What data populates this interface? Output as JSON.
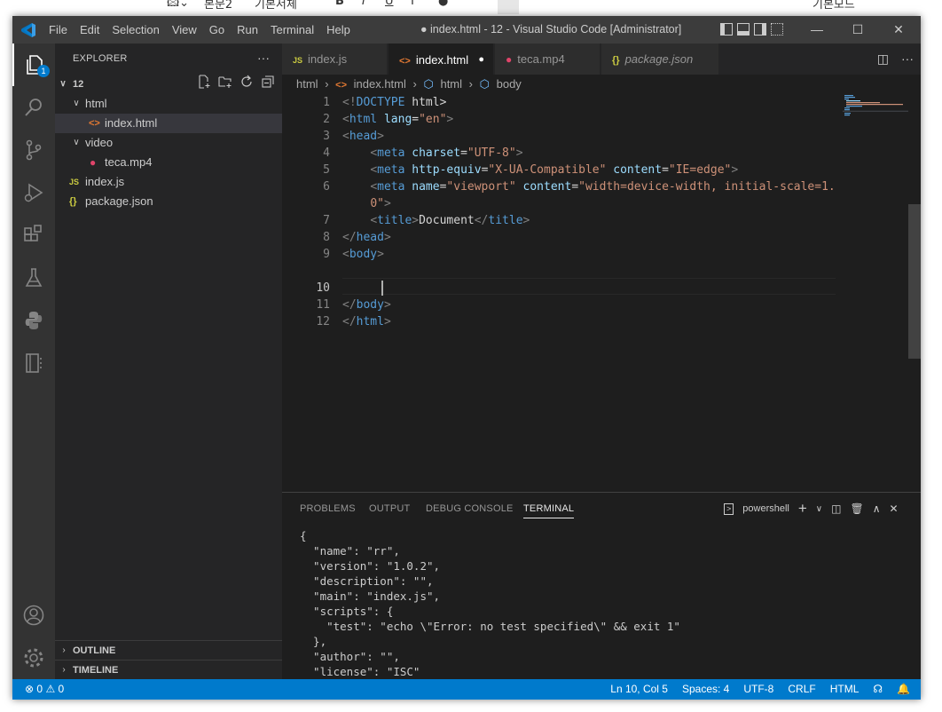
{
  "host_toolbar": {
    "items": [
      "본문2",
      "기본서체",
      "B",
      "I",
      "U",
      "T",
      "●",
      "“",
      "“",
      "기본모드"
    ]
  },
  "window": {
    "title": "● index.html - 12 - Visual Studio Code [Administrator]",
    "menu": [
      "File",
      "Edit",
      "Selection",
      "View",
      "Go",
      "Run",
      "Terminal",
      "Help"
    ],
    "controls": {
      "minimize": "—",
      "maximize": "☐",
      "close": "✕"
    }
  },
  "activity_bar": {
    "badge": "1",
    "items": [
      "explorer-icon",
      "search-icon",
      "source-control-icon",
      "run-debug-icon",
      "extensions-icon",
      "testing-icon",
      "python-icon",
      "notebook-icon",
      "account-icon",
      "settings-gear-icon"
    ]
  },
  "sidebar": {
    "title": "EXPLORER",
    "more": "···",
    "root": "12",
    "tree": [
      {
        "label": "html",
        "type": "folder",
        "icon": ""
      },
      {
        "label": "index.html",
        "type": "file",
        "icon": "<>"
      },
      {
        "label": "video",
        "type": "folder",
        "icon": ""
      },
      {
        "label": "teca.mp4",
        "type": "file",
        "icon": "●"
      },
      {
        "label": "index.js",
        "type": "file",
        "icon": "JS"
      },
      {
        "label": "package.json",
        "type": "file",
        "icon": "{}"
      }
    ],
    "outline": "OUTLINE",
    "timeline": "TIMELINE"
  },
  "tabs": [
    {
      "label": "index.js",
      "icon": "JS"
    },
    {
      "label": "index.html",
      "icon": "<>",
      "dirty": "●"
    },
    {
      "label": "teca.mp4",
      "icon": "●"
    },
    {
      "label": "package.json",
      "icon": "{}"
    }
  ],
  "breadcrumb": [
    "html",
    "index.html",
    "html",
    "body"
  ],
  "editor": {
    "active_line": "10",
    "line_numbers": [
      "1",
      "2",
      "3",
      "4",
      "5",
      "6",
      "",
      "7",
      "8",
      "9",
      "10",
      "11",
      "12"
    ],
    "lines": [
      "<!DOCTYPE html>",
      "<html lang=\"en\">",
      "<head>",
      "    <meta charset=\"UTF-8\">",
      "    <meta http-equiv=\"X-UA-Compatible\" content=\"IE=edge\">",
      "    <meta name=\"viewport\" content=\"width=device-width, initial-scale=1.",
      "    0\">",
      "    <title>Document</title>",
      "</head>",
      "<body>",
      "    ",
      "</body>",
      "</html>"
    ]
  },
  "panel": {
    "tabs": [
      "PROBLEMS",
      "OUTPUT",
      "DEBUG CONSOLE",
      "TERMINAL"
    ],
    "shell": "powershell",
    "terminal_lines": [
      "{",
      "  \"name\": \"rr\",",
      "  \"version\": \"1.0.2\",",
      "  \"description\": \"\",",
      "  \"main\": \"index.js\",",
      "  \"scripts\": {",
      "    \"test\": \"echo \\\"Error: no test specified\\\" && exit 1\"",
      "  },",
      "  \"author\": \"\",",
      "  \"license\": \"ISC\""
    ]
  },
  "status_bar": {
    "errors": "0",
    "warnings": "0",
    "position": "Ln 10, Col 5",
    "spaces": "Spaces: 4",
    "encoding": "UTF-8",
    "eol": "CRLF",
    "language": "HTML"
  }
}
